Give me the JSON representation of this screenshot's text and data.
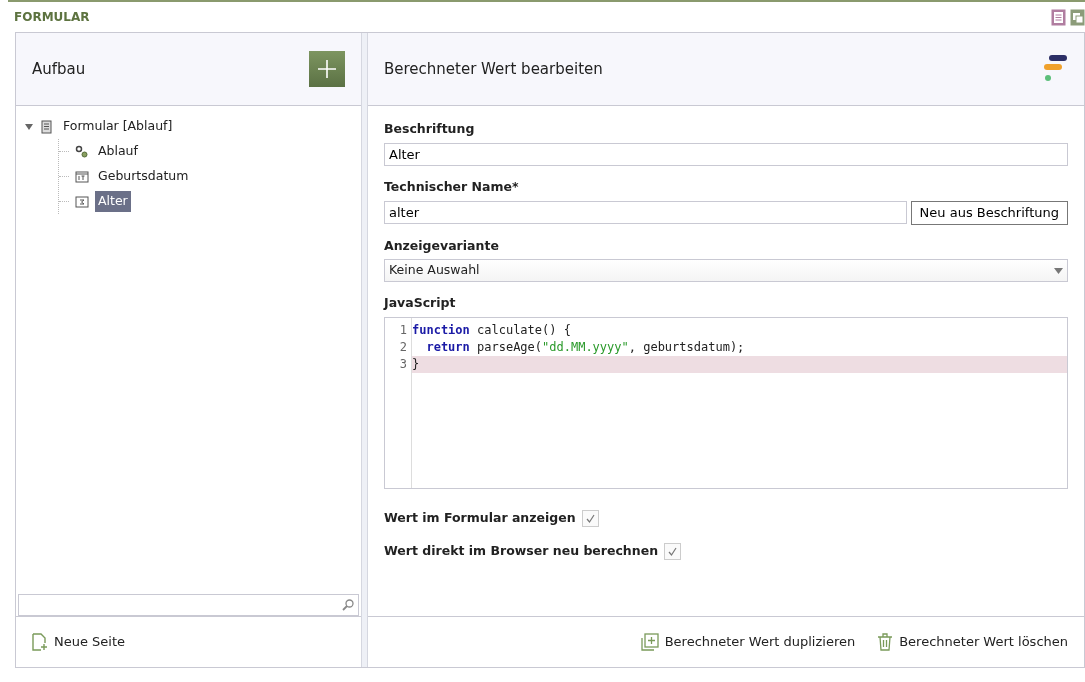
{
  "header": {
    "title": "FORMULAR"
  },
  "left": {
    "title": "Aufbau",
    "tree": [
      {
        "label": "Formular [Ablauf]",
        "kind": "form",
        "expanded": true,
        "selected": false,
        "children": [
          {
            "label": "Ablauf",
            "kind": "gears",
            "selected": false
          },
          {
            "label": "Geburtsdatum",
            "kind": "date",
            "selected": false
          },
          {
            "label": "Alter",
            "kind": "calc",
            "selected": true
          }
        ]
      }
    ],
    "footer_action": "Neue Seite"
  },
  "right": {
    "title": "Berechneter Wert bearbeiten",
    "label_field": {
      "label": "Beschriftung",
      "value": "Alter"
    },
    "name_field": {
      "label": "Technischer Name*",
      "value": "alter",
      "button": "Neu aus Beschriftung"
    },
    "variant_field": {
      "label": "Anzeigevariante",
      "value": "Keine Auswahl"
    },
    "code": {
      "label": "JavaScript",
      "lines": [
        {
          "number": "1",
          "highlighted": false,
          "tokens": [
            {
              "kind": "keyword",
              "text": "function"
            },
            {
              "kind": "plain",
              "text": " calculate() {"
            }
          ]
        },
        {
          "number": "2",
          "highlighted": false,
          "tokens": [
            {
              "kind": "keyword",
              "text": "  return"
            },
            {
              "kind": "plain",
              "text": " parseAge("
            },
            {
              "kind": "string",
              "text": "\"dd.MM.yyyy\""
            },
            {
              "kind": "plain",
              "text": ", geburtsdatum);"
            }
          ]
        },
        {
          "number": "3",
          "highlighted": true,
          "tokens": [
            {
              "kind": "plain",
              "text": "}"
            }
          ]
        }
      ]
    },
    "options": [
      {
        "label": "Wert im Formular anzeigen",
        "checked": true
      },
      {
        "label": "Wert direkt im Browser neu berechnen",
        "checked": true
      }
    ],
    "actions": [
      {
        "label": "Berechneter Wert duplizieren",
        "kind": "duplicate"
      },
      {
        "label": "Berechneter Wert löschen",
        "kind": "delete"
      }
    ]
  }
}
